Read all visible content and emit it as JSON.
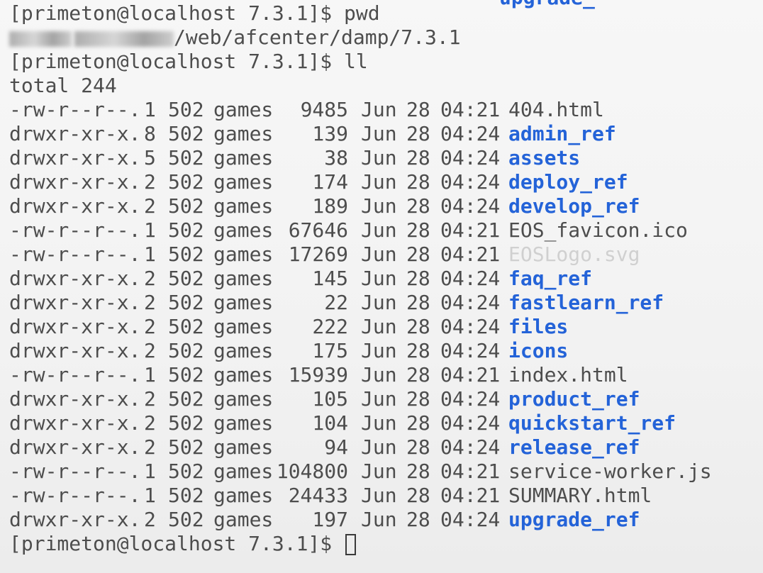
{
  "terminal": {
    "previous_output_fragment": "upgrade_",
    "prompt": "[primeton@localhost 7.3.1]$",
    "commands": {
      "pwd": "pwd",
      "ll": "ll"
    },
    "pwd_output_visible_suffix": "/web/afcenter/damp/7.3.1",
    "total_line": "total 244",
    "entries": [
      {
        "perm": "-rw-r--r--.",
        "links": "1",
        "owner": "502",
        "group": "games",
        "size": "9485",
        "month": "Jun",
        "day": "28",
        "time": "04:21",
        "name": "404.html",
        "type": "file"
      },
      {
        "perm": "drwxr-xr-x.",
        "links": "8",
        "owner": "502",
        "group": "games",
        "size": "139",
        "month": "Jun",
        "day": "28",
        "time": "04:24",
        "name": "admin_ref",
        "type": "dir"
      },
      {
        "perm": "drwxr-xr-x.",
        "links": "5",
        "owner": "502",
        "group": "games",
        "size": "38",
        "month": "Jun",
        "day": "28",
        "time": "04:24",
        "name": "assets",
        "type": "dir"
      },
      {
        "perm": "drwxr-xr-x.",
        "links": "2",
        "owner": "502",
        "group": "games",
        "size": "174",
        "month": "Jun",
        "day": "28",
        "time": "04:24",
        "name": "deploy_ref",
        "type": "dir"
      },
      {
        "perm": "drwxr-xr-x.",
        "links": "2",
        "owner": "502",
        "group": "games",
        "size": "189",
        "month": "Jun",
        "day": "28",
        "time": "04:24",
        "name": "develop_ref",
        "type": "dir"
      },
      {
        "perm": "-rw-r--r--.",
        "links": "1",
        "owner": "502",
        "group": "games",
        "size": "67646",
        "month": "Jun",
        "day": "28",
        "time": "04:21",
        "name": "EOS_favicon.ico",
        "type": "file"
      },
      {
        "perm": "-rw-r--r--.",
        "links": "1",
        "owner": "502",
        "group": "games",
        "size": "17269",
        "month": "Jun",
        "day": "28",
        "time": "04:21",
        "name": "EOSLogo.svg",
        "type": "faded"
      },
      {
        "perm": "drwxr-xr-x.",
        "links": "2",
        "owner": "502",
        "group": "games",
        "size": "145",
        "month": "Jun",
        "day": "28",
        "time": "04:24",
        "name": "faq_ref",
        "type": "dir"
      },
      {
        "perm": "drwxr-xr-x.",
        "links": "2",
        "owner": "502",
        "group": "games",
        "size": "22",
        "month": "Jun",
        "day": "28",
        "time": "04:24",
        "name": "fastlearn_ref",
        "type": "dir"
      },
      {
        "perm": "drwxr-xr-x.",
        "links": "2",
        "owner": "502",
        "group": "games",
        "size": "222",
        "month": "Jun",
        "day": "28",
        "time": "04:24",
        "name": "files",
        "type": "dir"
      },
      {
        "perm": "drwxr-xr-x.",
        "links": "2",
        "owner": "502",
        "group": "games",
        "size": "175",
        "month": "Jun",
        "day": "28",
        "time": "04:24",
        "name": "icons",
        "type": "dir"
      },
      {
        "perm": "-rw-r--r--.",
        "links": "1",
        "owner": "502",
        "group": "games",
        "size": "15939",
        "month": "Jun",
        "day": "28",
        "time": "04:21",
        "name": "index.html",
        "type": "file"
      },
      {
        "perm": "drwxr-xr-x.",
        "links": "2",
        "owner": "502",
        "group": "games",
        "size": "105",
        "month": "Jun",
        "day": "28",
        "time": "04:24",
        "name": "product_ref",
        "type": "dir"
      },
      {
        "perm": "drwxr-xr-x.",
        "links": "2",
        "owner": "502",
        "group": "games",
        "size": "104",
        "month": "Jun",
        "day": "28",
        "time": "04:24",
        "name": "quickstart_ref",
        "type": "dir"
      },
      {
        "perm": "drwxr-xr-x.",
        "links": "2",
        "owner": "502",
        "group": "games",
        "size": "94",
        "month": "Jun",
        "day": "28",
        "time": "04:24",
        "name": "release_ref",
        "type": "dir"
      },
      {
        "perm": "-rw-r--r--.",
        "links": "1",
        "owner": "502",
        "group": "games",
        "size": "104800",
        "month": "Jun",
        "day": "28",
        "time": "04:21",
        "name": "service-worker.js",
        "type": "file"
      },
      {
        "perm": "-rw-r--r--.",
        "links": "1",
        "owner": "502",
        "group": "games",
        "size": "24433",
        "month": "Jun",
        "day": "28",
        "time": "04:21",
        "name": "SUMMARY.html",
        "type": "file"
      },
      {
        "perm": "drwxr-xr-x.",
        "links": "2",
        "owner": "502",
        "group": "games",
        "size": "197",
        "month": "Jun",
        "day": "28",
        "time": "04:24",
        "name": "upgrade_ref",
        "type": "dir"
      }
    ],
    "colors": {
      "background": "#f4f4f4",
      "text": "#4d4d4d",
      "directory": "#2463d8",
      "faded": "#d0d0d0"
    }
  }
}
